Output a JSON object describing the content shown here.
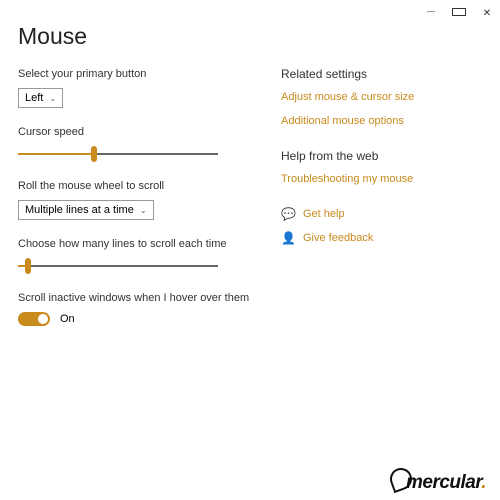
{
  "window": {
    "title": "Mouse"
  },
  "primary": {
    "label": "Select your primary button",
    "value": "Left"
  },
  "cursor_speed": {
    "label": "Cursor speed",
    "percent": 38
  },
  "wheel": {
    "label": "Roll the mouse wheel to scroll",
    "value": "Multiple lines at a time"
  },
  "lines": {
    "label": "Choose how many lines to scroll each time",
    "percent": 5
  },
  "inactive": {
    "label": "Scroll inactive windows when I hover over them",
    "state": "On"
  },
  "related": {
    "heading": "Related settings",
    "links": [
      "Adjust mouse & cursor size",
      "Additional mouse options"
    ]
  },
  "webhelp": {
    "heading": "Help from the web",
    "links": [
      "Troubleshooting my mouse"
    ]
  },
  "actions": {
    "help": "Get help",
    "feedback": "Give feedback"
  },
  "logo": "mercular"
}
